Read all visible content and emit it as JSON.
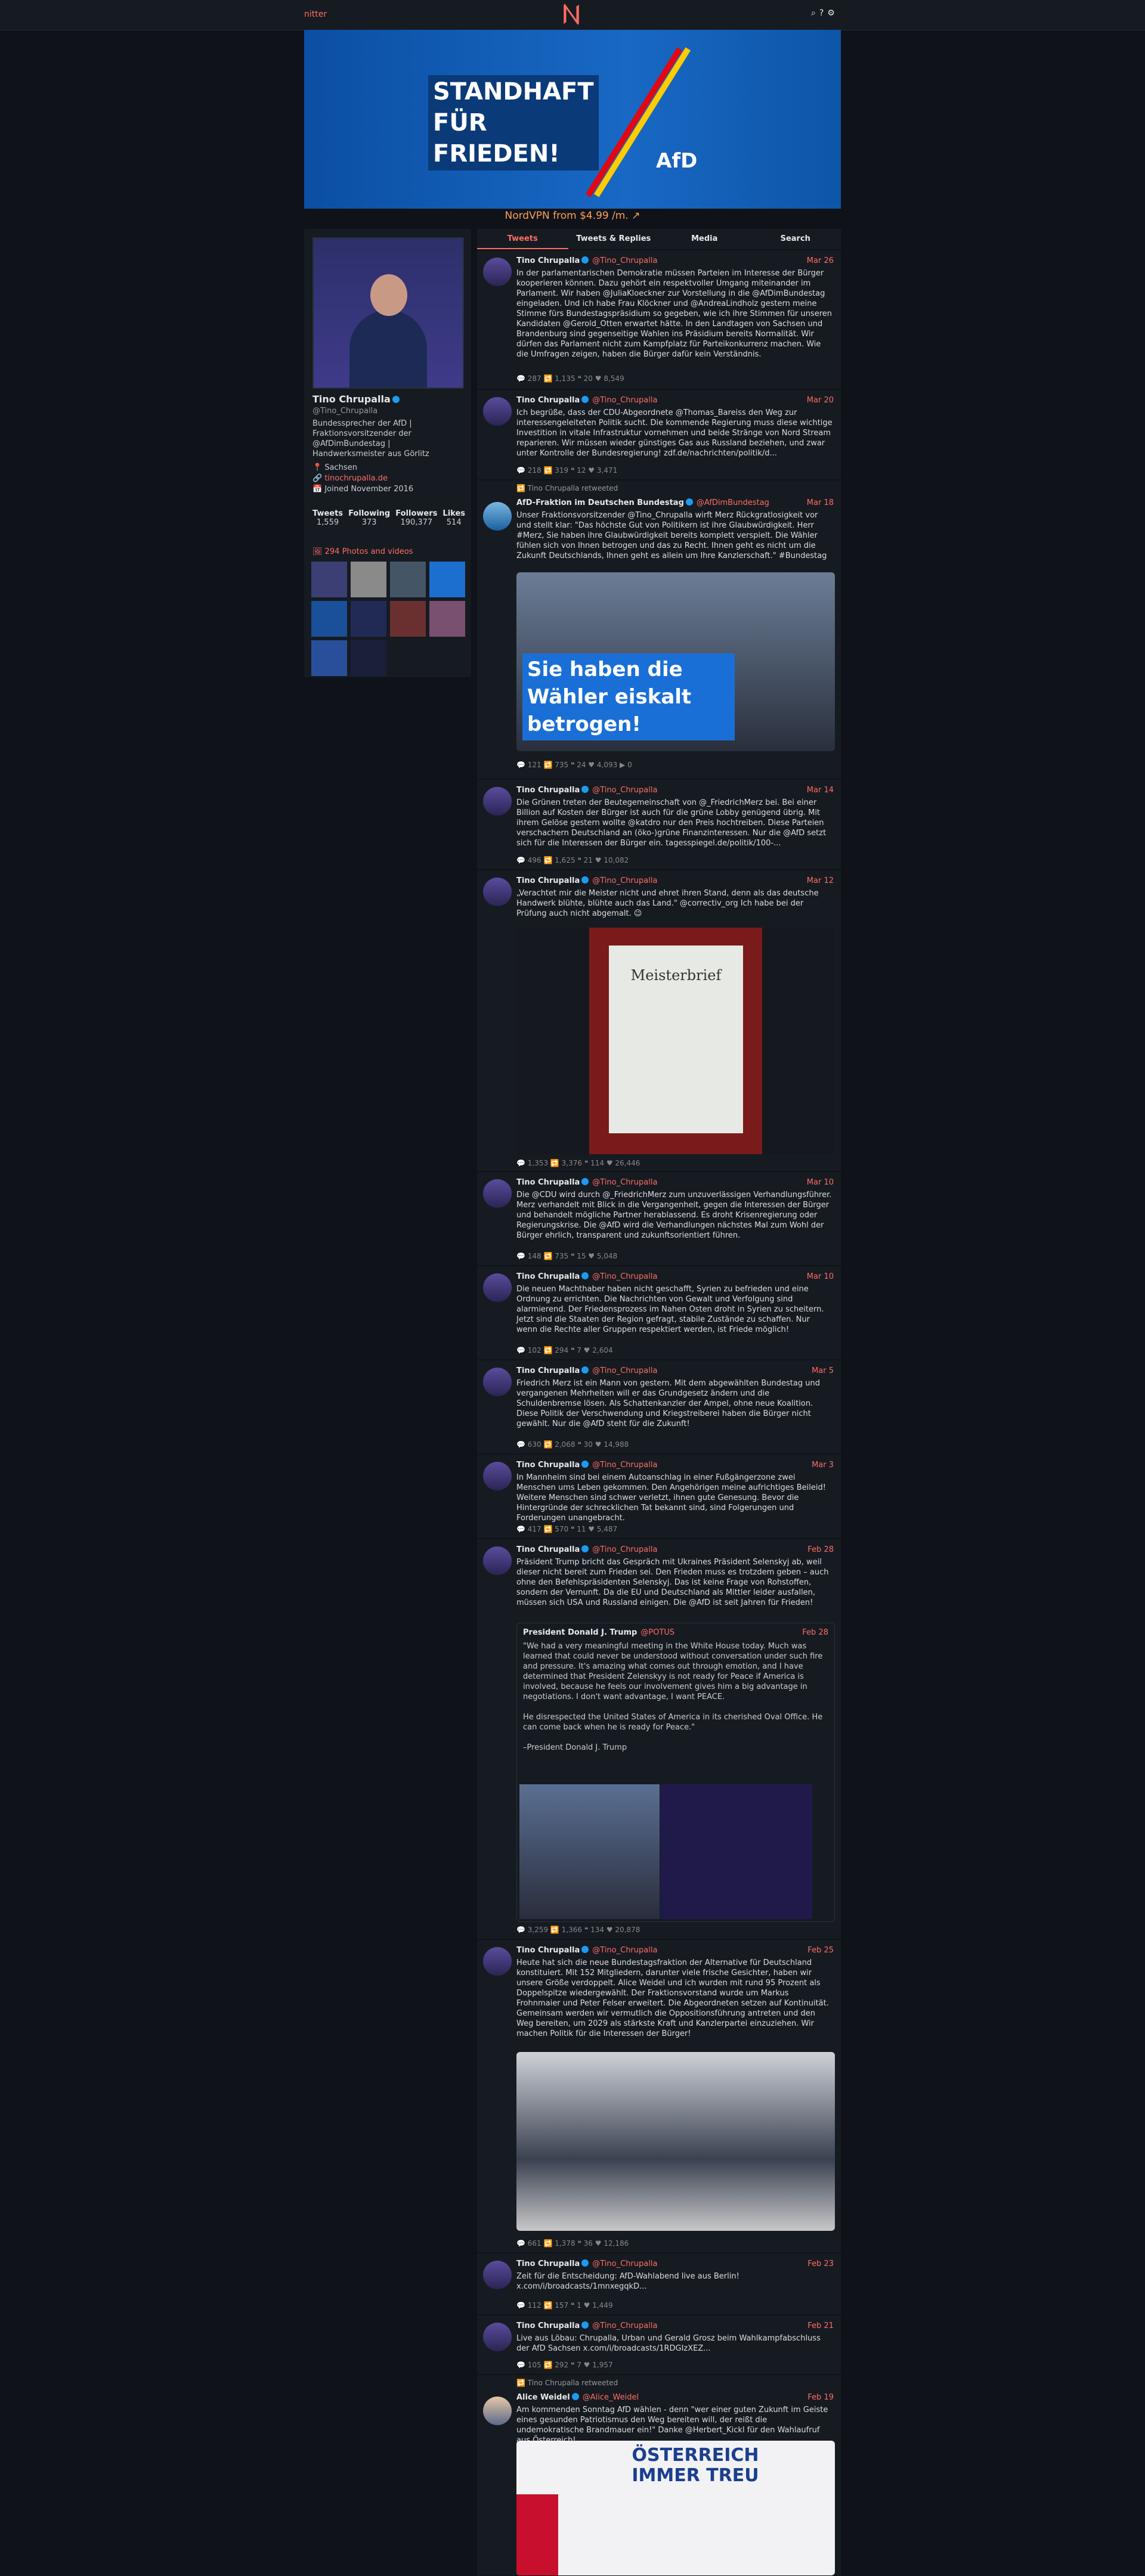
{
  "nav": {
    "brand": "nitter",
    "icons": [
      "search-icon",
      "help-icon",
      "gear-icon"
    ]
  },
  "banner": {
    "slogan_line1": "STANDHAFT",
    "slogan_line2": "FÜR",
    "slogan_line3": "FRIEDEN!",
    "party": "AfD"
  },
  "sponsor": "NordVPN from $4.99 /m. ↗",
  "profile": {
    "name": "Tino Chrupalla",
    "handle": "@Tino_Chrupalla",
    "bio": "Bundessprecher der AfD | Fraktionsvorsitzender der @AfDimBundestag | Handwerksmeister aus Görlitz",
    "location": "📍 Sachsen",
    "website": "🔗 tinochrupalla.de",
    "joined": "📅 Joined November 2016",
    "stats": [
      {
        "label": "Tweets",
        "value": "1,559"
      },
      {
        "label": "Following",
        "value": "373"
      },
      {
        "label": "Followers",
        "value": "190,377"
      },
      {
        "label": "Likes",
        "value": "514"
      }
    ],
    "photos_label": "🖼 294 Photos and videos"
  },
  "tabs": [
    "Tweets",
    "Tweets & Replies",
    "Media",
    "Search"
  ],
  "tweets": [
    {
      "name": "Tino Chrupalla",
      "handle": "@Tino_Chrupalla",
      "date": "Mar 26",
      "retweet": "",
      "text": "In der parlamentarischen Demokratie müssen Parteien im Interesse der Bürger kooperieren können. Dazu gehört ein respektvoller Umgang miteinander im Parlament. Wir haben @JuliaKloeckner zur Vorstellung in die @AfDimBundestag eingeladen. Und ich habe Frau Klöckner und @AndreaLindholz gestern meine Stimme fürs Bundestagspräsidium so gegeben, wie ich ihre Stimmen für unseren Kandidaten @Gerold_Otten erwartet hätte. In den Landtagen von Sachsen und Brandenburg sind gegenseitige Wahlen ins Präsidium bereits Normalität. Wir dürfen das Parlament nicht zum Kampfplatz für Parteikonkurrenz machen. Wie die Umfragen zeigen, haben die Bürger dafür kein Verständnis.",
      "stats": "💬 287   🔁 1,135   ❝ 20   ♥ 8,549"
    },
    {
      "name": "Tino Chrupalla",
      "handle": "@Tino_Chrupalla",
      "date": "Mar 20",
      "retweet": "",
      "text": "Ich begrüße, dass der CDU-Abgeordnete @Thomas_Bareiss den Weg zur interessengeleiteten Politik sucht. Die kommende Regierung muss diese wichtige Investition in vitale Infrastruktur vornehmen und beide Stränge von Nord Stream reparieren. Wir müssen wieder günstiges Gas aus Russland beziehen, und zwar unter Kontrolle der Bundesregierung! zdf.de/nachrichten/politik/d...",
      "stats": "💬 218   🔁 319   ❝ 12   ♥ 3,471"
    },
    {
      "name": "AfD-Fraktion im Deutschen Bundestag",
      "handle": "@AfDimBundestag",
      "date": "Mar 18",
      "retweet": "🔁 Tino Chrupalla retweeted",
      "text": "Unser Fraktionsvorsitzender @Tino_Chrupalla wirft Merz Rückgratlosigkeit vor und stellt klar: \"Das höchste Gut von Politikern ist ihre Glaubwürdigkeit. Herr #Merz, Sie haben ihre Glaubwürdigkeit bereits komplett verspielt. Die Wähler fühlen sich von Ihnen betrogen und das zu Recht. Ihnen geht es nicht um die Zukunft Deutschlands, Ihnen geht es allein um Ihre Kanzlerschaft.\" #Bundestag",
      "image_text": "Sie haben die Wähler eiskalt betrogen!",
      "stats": "💬 121   🔁 735   ❝ 24   ♥ 4,093   ▶ 0"
    },
    {
      "name": "Tino Chrupalla",
      "handle": "@Tino_Chrupalla",
      "date": "Mar 14",
      "retweet": "",
      "text": "Die Grünen treten der Beutegemeinschaft von @_FriedrichMerz bei. Bei einer Billion auf Kosten der Bürger ist auch für die grüne Lobby genügend übrig. Mit ihrem Gelöse gestern wollte @katdro nur den Preis hochtreiben. Diese Parteien verschachern Deutschland an (öko-)grüne Finanzinteressen. Nur die @AfD setzt sich für die Interessen der Bürger ein. tagesspiegel.de/politik/100-...",
      "stats": "💬 496   🔁 1,625   ❝ 21   ♥ 10,082"
    },
    {
      "name": "Tino Chrupalla",
      "handle": "@Tino_Chrupalla",
      "date": "Mar 12",
      "retweet": "",
      "text": "„Verachtet mir die Meister nicht und ehret ihren Stand, denn als das deutsche Handwerk blühte, blühte auch das Land.\" @correctiv_org Ich habe bei der Prüfung auch nicht abgemalt. 😉",
      "image_text": "Meisterbrief",
      "stats": "💬 1,353   🔁 3,376   ❝ 114   ♥ 26,446"
    },
    {
      "name": "Tino Chrupalla",
      "handle": "@Tino_Chrupalla",
      "date": "Mar 10",
      "retweet": "",
      "text": "Die @CDU wird durch @_FriedrichMerz zum unzuverlässigen Verhandlungsführer. Merz verhandelt mit Blick in die Vergangenheit, gegen die Interessen der Bürger und behandelt mögliche Partner herablassend. Es droht Krisenregierung oder Regierungskrise. Die @AfD wird die Verhandlungen nächstes Mal zum Wohl der Bürger ehrlich, transparent und zukunftsorientiert führen.",
      "stats": "💬 148   🔁 735   ❝ 15   ♥ 5,048"
    },
    {
      "name": "Tino Chrupalla",
      "handle": "@Tino_Chrupalla",
      "date": "Mar 10",
      "retweet": "",
      "text": "Die neuen Machthaber haben nicht geschafft, Syrien zu befrieden und eine Ordnung zu errichten. Die Nachrichten von Gewalt und Verfolgung sind alarmierend. Der Friedensprozess im Nahen Osten droht in Syrien zu scheitern. Jetzt sind die Staaten der Region gefragt, stabile Zustände zu schaffen. Nur wenn die Rechte aller Gruppen respektiert werden, ist Friede möglich!",
      "stats": "💬 102   🔁 294   ❝ 7   ♥ 2,604"
    },
    {
      "name": "Tino Chrupalla",
      "handle": "@Tino_Chrupalla",
      "date": "Mar 5",
      "retweet": "",
      "text": "Friedrich Merz ist ein Mann von gestern. Mit dem abgewählten Bundestag und vergangenen Mehrheiten will er das Grundgesetz ändern und die Schuldenbremse lösen. Als Schattenkanzler der Ampel, ohne neue Koalition. Diese Politik der Verschwendung und Kriegstreiberei haben die Bürger nicht gewählt. Nur die @AfD steht für die Zukunft!",
      "stats": "💬 630   🔁 2,068   ❝ 30   ♥ 14,988"
    },
    {
      "name": "Tino Chrupalla",
      "handle": "@Tino_Chrupalla",
      "date": "Mar 3",
      "retweet": "",
      "text": "In Mannheim sind bei einem Autoanschlag in einer Fußgängerzone zwei Menschen ums Leben gekommen. Den Angehörigen meine aufrichtiges Beileid! Weitere Menschen sind schwer verletzt, ihnen gute Genesung. Bevor die Hintergründe der schrecklichen Tat bekannt sind, sind Folgerungen und Forderungen unangebracht.",
      "stats": "💬 417   🔁 570   ❝ 11   ♥ 5,487"
    },
    {
      "name": "Tino Chrupalla",
      "handle": "@Tino_Chrupalla",
      "date": "Feb 28",
      "retweet": "",
      "text": "Präsident Trump bricht das Gespräch mit Ukraines Präsident Selenskyj ab, weil dieser nicht bereit zum Frieden sei. Den Frieden muss es trotzdem geben – auch ohne den Befehlspräsidenten Selenskyj. Das ist keine Frage von Rohstoffen, sondern der Vernunft. Da die EU und Deutschland als Mittler leider ausfallen, müssen sich USA und Russland einigen. Die @AfD ist seit Jahren für Frieden!",
      "quote_name": "President Donald J. Trump",
      "quote_handle": "@POTUS",
      "quote_date": "Feb 28",
      "quote_text": "\"We had a very meaningful meeting in the White House today. Much was learned that could never be understood without conversation under such fire and pressure. It's amazing what comes out through emotion, and I have determined that President Zelenskyy is not ready for Peace if America is involved, because he feels our involvement gives him a big advantage in negotiations. I don't want advantage, I want PEACE.\n\nHe disrespected the United States of America in its cherished Oval Office. He can come back when he is ready for Peace.\"\n\n–President Donald J. Trump",
      "stats": "💬 3,259   🔁 1,366   ❝ 134   ♥ 20,878"
    },
    {
      "name": "Tino Chrupalla",
      "handle": "@Tino_Chrupalla",
      "date": "Feb 25",
      "retweet": "",
      "text": "Heute hat sich die neue Bundestagsfraktion der Alternative für Deutschland konstituiert. Mit 152 Mitgliedern, darunter viele frische Gesichter, haben wir unsere Größe verdoppelt. Alice Weidel und ich wurden mit rund 95 Prozent als Doppelspitze wiedergewählt. Der Fraktionsvorstand wurde um Markus Frohnmaier und Peter Felser erweitert. Die Abgeordneten setzen auf Kontinuität. Gemeinsam werden wir vermutlich die Oppositionsführung antreten und den Weg bereiten, um 2029 als stärkste Kraft und Kanzlerpartei einzuziehen. Wir machen Politik für die Interessen der Bürger!",
      "stats": "💬 661   🔁 1,378   ❝ 36   ♥ 12,186"
    },
    {
      "name": "Tino Chrupalla",
      "handle": "@Tino_Chrupalla",
      "date": "Feb 23",
      "retweet": "",
      "text": "Zeit für die Entscheidung: AfD-Wahlabend live aus Berlin!\nx.com/i/broadcasts/1mnxegqkD...",
      "stats": "💬 112   🔁 157   ❝ 1   ♥ 1,449"
    },
    {
      "name": "Tino Chrupalla",
      "handle": "@Tino_Chrupalla",
      "date": "Feb 21",
      "retweet": "",
      "text": "Live aus Löbau: Chrupalla, Urban und Gerald Grosz beim Wahlkampfabschluss der AfD Sachsen x.com/i/broadcasts/1RDGIzXEZ...",
      "stats": "💬 105   🔁 292   ❝ 7   ♥ 1,957"
    },
    {
      "name": "Alice Weidel",
      "handle": "@Alice_Weidel",
      "date": "Feb 19",
      "retweet": "🔁 Tino Chrupalla retweeted",
      "text": "Am kommenden Sonntag AfD wählen - denn \"wer einer guten Zukunft im Geiste eines gesunden Patriotismus den Weg bereiten will, der reißt die undemokratische Brandmauer ein!\" Danke @Herbert_Kickl für den Wahlaufruf aus Österreich!",
      "image_text": "ÖSTERREICH IMMER TREU",
      "stats": ""
    }
  ]
}
